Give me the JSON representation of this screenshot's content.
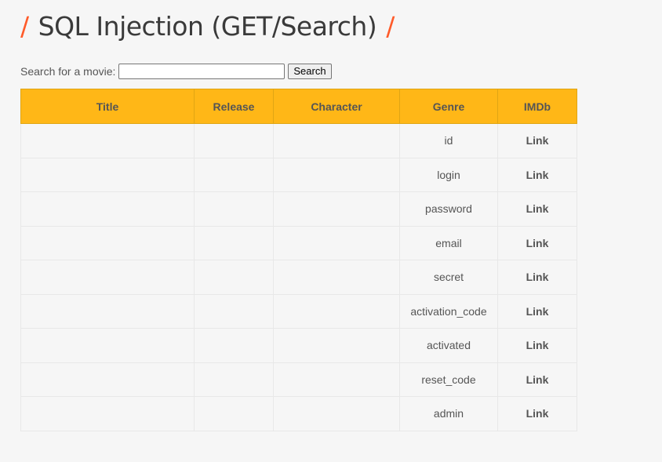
{
  "page": {
    "title_slash": "/",
    "title": "SQL Injection (GET/Search)"
  },
  "search": {
    "label": "Search for a movie:",
    "value": "",
    "placeholder": "",
    "button_label": "Search"
  },
  "table": {
    "headers": [
      "Title",
      "Release",
      "Character",
      "Genre",
      "IMDb"
    ],
    "rows": [
      {
        "title": "",
        "release": "",
        "character": "",
        "genre": "id",
        "imdb": "Link"
      },
      {
        "title": "",
        "release": "",
        "character": "",
        "genre": "login",
        "imdb": "Link"
      },
      {
        "title": "",
        "release": "",
        "character": "",
        "genre": "password",
        "imdb": "Link"
      },
      {
        "title": "",
        "release": "",
        "character": "",
        "genre": "email",
        "imdb": "Link"
      },
      {
        "title": "",
        "release": "",
        "character": "",
        "genre": "secret",
        "imdb": "Link"
      },
      {
        "title": "",
        "release": "",
        "character": "",
        "genre": "activation_code",
        "imdb": "Link"
      },
      {
        "title": "",
        "release": "",
        "character": "",
        "genre": "activated",
        "imdb": "Link"
      },
      {
        "title": "",
        "release": "",
        "character": "",
        "genre": "reset_code",
        "imdb": "Link"
      },
      {
        "title": "",
        "release": "",
        "character": "",
        "genre": "admin",
        "imdb": "Link"
      }
    ]
  },
  "colors": {
    "accent_slash": "#ff5b2a",
    "header_background": "#ffb717",
    "page_background": "#f6f6f6"
  }
}
